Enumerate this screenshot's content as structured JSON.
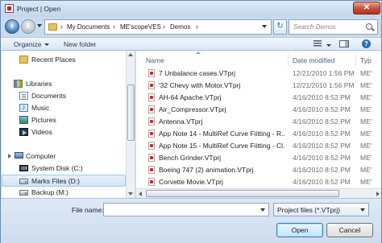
{
  "window": {
    "title": "Project | Open",
    "close_label": "✕"
  },
  "address": {
    "crumbs": [
      "My Documents",
      "ME'scopeVES",
      "Demos"
    ],
    "refresh_glyph": "↻"
  },
  "search": {
    "placeholder": "Search Demos"
  },
  "toolbar": {
    "organize_label": "Organize",
    "new_folder_label": "New folder",
    "help_glyph": "?"
  },
  "nav": {
    "items": [
      {
        "label": "Recent Places",
        "icon": "folder-icon"
      },
      {
        "label": "Libraries",
        "icon": "libraries-icon"
      },
      {
        "label": "Documents",
        "icon": "documents-icon"
      },
      {
        "label": "Music",
        "icon": "music-icon"
      },
      {
        "label": "Pictures",
        "icon": "pictures-icon"
      },
      {
        "label": "Videos",
        "icon": "videos-icon"
      },
      {
        "label": "Computer",
        "icon": "computer-icon"
      },
      {
        "label": "System Disk (C:)",
        "icon": "system-drive-icon"
      },
      {
        "label": "Marks Files (D:)",
        "icon": "drive-icon",
        "selected": true
      },
      {
        "label": "Backup (M:)",
        "icon": "drive-icon"
      }
    ]
  },
  "files": {
    "columns": {
      "name": "Name",
      "date": "Date modified",
      "type": "Typ"
    },
    "rows": [
      {
        "name": "7 Unbalance cases.VTprj",
        "date": "12/21/2010 1:56 PM",
        "type": "ME'"
      },
      {
        "name": "'32 Chevy with Motor.VTprj",
        "date": "12/21/2010 1:56 PM",
        "type": "ME'"
      },
      {
        "name": "AH-64 Apache.VTprj",
        "date": "4/16/2010 8:52 PM",
        "type": "ME'"
      },
      {
        "name": "Air_Compressor.VTprj",
        "date": "4/16/2010 8:52 PM",
        "type": "ME'"
      },
      {
        "name": "Antenna.VTprj",
        "date": "4/16/2010 8:52 PM",
        "type": "ME'"
      },
      {
        "name": "App Note 14 - MultiRef Curve Fiitting - R...",
        "date": "4/16/2010 8:52 PM",
        "type": "ME'"
      },
      {
        "name": "App Note 15 - MultiRef Curve Fiitting - Cl...",
        "date": "4/16/2010 8:52 PM",
        "type": "ME'"
      },
      {
        "name": "Bench Grinder.VTprj",
        "date": "4/16/2010 8:52 PM",
        "type": "ME'"
      },
      {
        "name": "Boeing 747 (2) animation.VTprj",
        "date": "4/16/2010 8:52 PM",
        "type": "ME'"
      },
      {
        "name": "Corvette Movie.VTprj",
        "date": "4/16/2010 8:52 PM",
        "type": "ME'"
      }
    ]
  },
  "bottom": {
    "file_name_label": "File name:",
    "file_name_value": "",
    "filter_value": "Project files (*.VTprj)",
    "open_label": "Open",
    "cancel_label": "Cancel"
  }
}
